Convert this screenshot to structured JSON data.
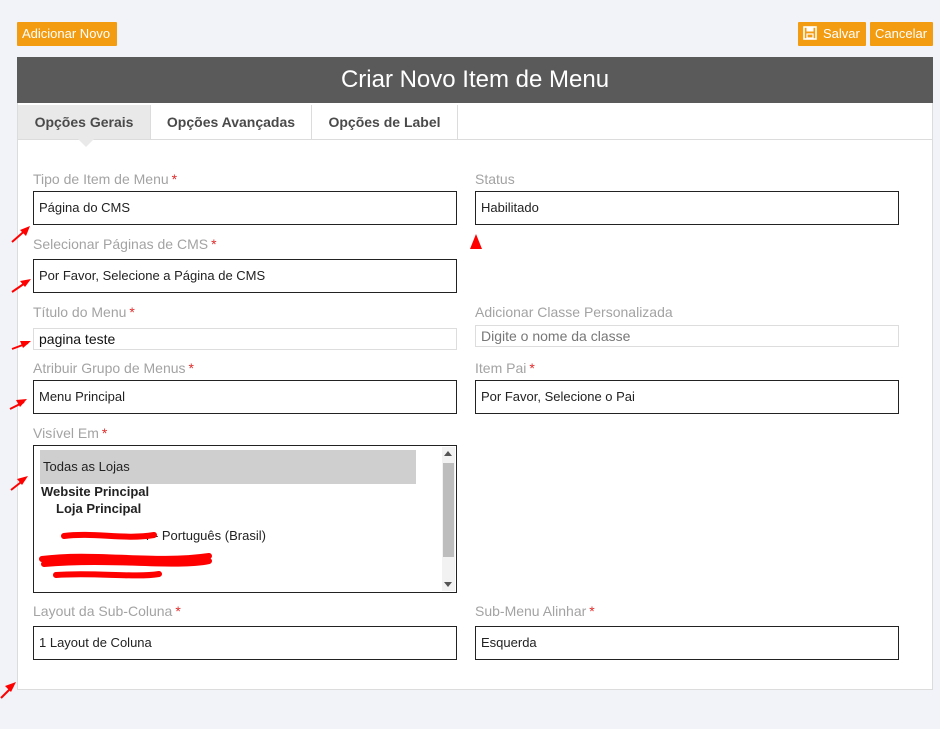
{
  "toolbar": {
    "add_label": "Adicionar Novo",
    "save_label": "Salvar",
    "cancel_label": "Cancelar"
  },
  "panel": {
    "title": "Criar Novo Item de Menu",
    "tabs": [
      {
        "label": "Opções Gerais",
        "active": true
      },
      {
        "label": "Opções Avançadas",
        "active": false
      },
      {
        "label": "Opções de Label",
        "active": false
      }
    ]
  },
  "form": {
    "menu_type": {
      "label": "Tipo de Item de Menu",
      "required": "*",
      "value": "Página do CMS"
    },
    "status": {
      "label": "Status",
      "value": "Habilitado"
    },
    "cms_pages": {
      "label": "Selecionar Páginas de CMS",
      "required": "*",
      "value": "Por Favor, Selecione a Página de CMS"
    },
    "menu_title": {
      "label": "Título do Menu",
      "required": "*",
      "value": "pagina teste"
    },
    "custom_class": {
      "label": "Adicionar Classe Personalizada",
      "placeholder": "Digite o nome da classe"
    },
    "menu_group": {
      "label": "Atribuir Grupo de Menus",
      "required": "*",
      "value": "Menu Principal"
    },
    "parent_item": {
      "label": "Item Pai",
      "required": "*",
      "value": "Por Favor, Selecione o Pai"
    },
    "visible_in": {
      "label": "Visível Em",
      "required": "*",
      "options": {
        "all_stores": "Todas as Lojas",
        "main_website": "Website Principal",
        "main_store": "Loja Principal",
        "store_view": "r - Português (Brasil)"
      }
    },
    "subcolumn_layout": {
      "label": "Layout da Sub-Coluna",
      "required": "*",
      "value": "1 Layout de Coluna"
    },
    "submenu_align": {
      "label": "Sub-Menu Alinhar",
      "required": "*",
      "value": "Esquerda"
    }
  },
  "colors": {
    "accent": "#f39c12",
    "header": "#5a5a5a",
    "annotation": "#ff0000"
  }
}
